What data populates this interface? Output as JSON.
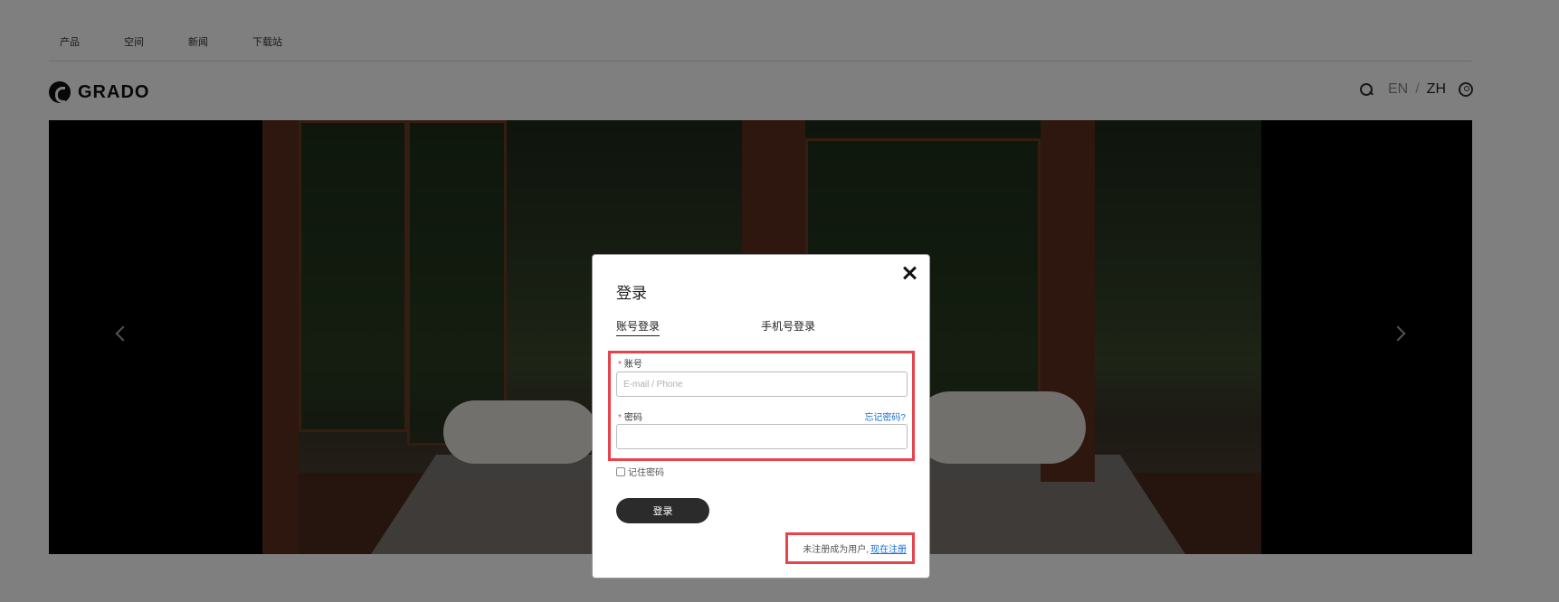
{
  "topnav": {
    "items": [
      "产品",
      "空间",
      "新闻",
      "下载站"
    ]
  },
  "header": {
    "brand": "GRADO",
    "lang_en": "EN",
    "lang_sep": "/",
    "lang_zh": "ZH"
  },
  "login_modal": {
    "title": "登录",
    "tabs": {
      "account": "账号登录",
      "phone": "手机号登录"
    },
    "account_field": {
      "required_mark": "*",
      "label": "账号",
      "placeholder": "E-mail / Phone",
      "value": ""
    },
    "password_field": {
      "required_mark": "*",
      "label": "密码",
      "value": ""
    },
    "forgot_password": "忘记密码?",
    "remember_password": "记住密码",
    "remember_checked": false,
    "login_button": "登录",
    "register_prompt": "未注册成为用户,",
    "register_link": "现在注册"
  },
  "colors": {
    "highlight": "#e8424a",
    "link": "#1a6fd6",
    "button": "#2b2b2b"
  }
}
